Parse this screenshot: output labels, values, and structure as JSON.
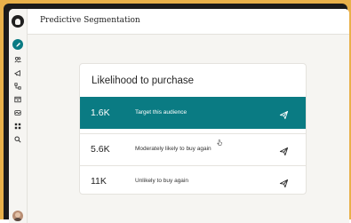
{
  "app": {
    "page_title": "Predictive Segmentation"
  },
  "sidebar": {
    "items": [
      {
        "icon": "pencil-icon",
        "label": ""
      },
      {
        "icon": "audience-icon",
        "label": ""
      },
      {
        "icon": "campaign-icon",
        "label": ""
      },
      {
        "icon": "automation-icon",
        "label": ""
      },
      {
        "icon": "website-icon",
        "label": ""
      },
      {
        "icon": "content-icon",
        "label": ""
      },
      {
        "icon": "analytics-icon",
        "label": ""
      },
      {
        "icon": "search-icon",
        "label": ""
      }
    ]
  },
  "card": {
    "title": "Likelihood to purchase",
    "rows": [
      {
        "count": "1.6K",
        "label": "Target this audience",
        "selected": true
      },
      {
        "count": "5.6K",
        "label": "Moderately likely to buy again",
        "selected": false
      },
      {
        "count": "11K",
        "label": "Unlikely to buy again",
        "selected": false
      }
    ]
  },
  "colors": {
    "accent": "#0a7b83",
    "frame": "#e9b14a",
    "background": "#f6f5f2"
  }
}
